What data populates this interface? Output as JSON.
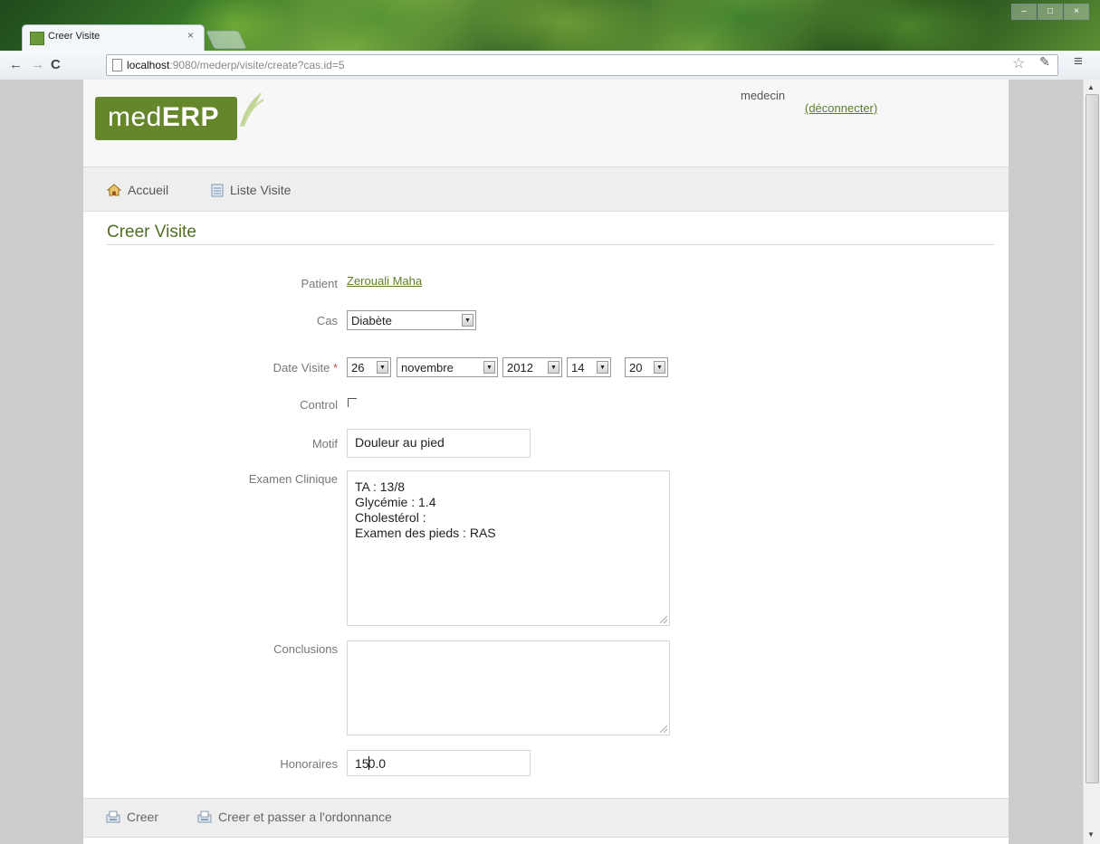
{
  "browser": {
    "tab_title": "Creer Visite",
    "tab_close": "×",
    "url_host": "localhost",
    "url_rest": ":9080/mederp/visite/create?cas.id=5",
    "window_controls": [
      "–",
      "□",
      "×"
    ]
  },
  "header": {
    "logo_light": "med",
    "logo_bold": "ERP",
    "username": "medecin",
    "logout_label": "(déconnecter)"
  },
  "nav": {
    "home_label": "Accueil",
    "list_label": "Liste Visite"
  },
  "page_title": "Creer Visite",
  "form": {
    "patient_label": "Patient",
    "patient_value": "Zerouali Maha",
    "cas_label": "Cas",
    "cas_value": "Diabète",
    "date_label": "Date Visite",
    "date_required": "*",
    "date_day": "26",
    "date_month": "novembre",
    "date_year": "2012",
    "date_hour": "14",
    "date_minute": "20",
    "control_label": "Control",
    "control_checked": false,
    "motif_label": "Motif",
    "motif_value": "Douleur au pied",
    "examen_label": "Examen Clinique",
    "examen_lines": [
      "TA : 13/8",
      "Glycémie : 1.4",
      "Cholestérol :",
      "Examen des pieds : RAS"
    ],
    "conclusions_label": "Conclusions",
    "conclusions_value": "",
    "honoraires_label": "Honoraires",
    "honoraires_before_caret": "15",
    "honoraires_after_caret": "0.0"
  },
  "actions": {
    "create_label": "Creer",
    "create_prescription_label": "Creer et passer a l'ordonnance"
  },
  "colors": {
    "brand_green": "#66862c",
    "link_green": "#5e7d28"
  }
}
